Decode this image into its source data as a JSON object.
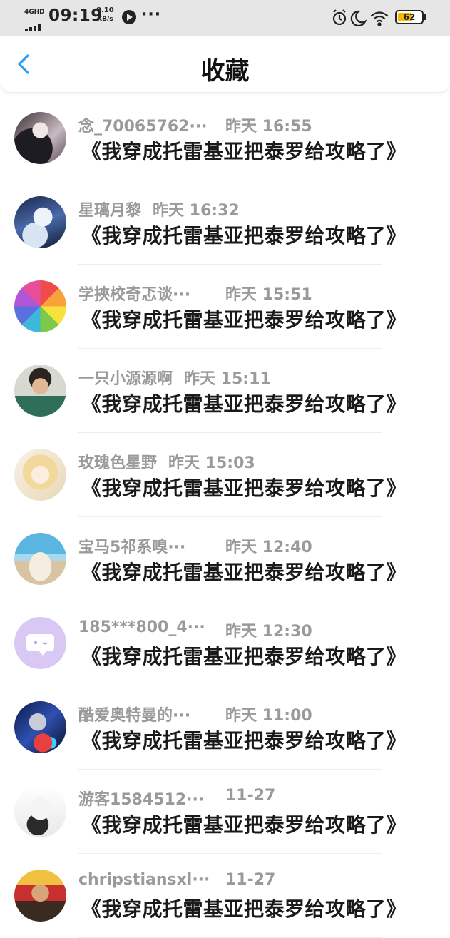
{
  "status_bar": {
    "network": "4GHD",
    "time": "09:19",
    "speed_value": "0.10",
    "speed_unit": "KB/s",
    "more": "···",
    "battery": "62",
    "battery_level": 0.62
  },
  "header": {
    "title": "收藏"
  },
  "favorites": [
    {
      "user": "念_70065762···",
      "time": "昨天 16:55",
      "title": "《我穿成托雷基亚把泰罗给攻略了》",
      "avatar": "dark-girl-avatar"
    },
    {
      "user": "星璃月黎",
      "time": "昨天 16:32",
      "title": "《我穿成托雷基亚把泰罗给攻略了》",
      "avatar": "anime-white-hair-avatar"
    },
    {
      "user": "学挾校奇忑谈···",
      "time": "昨天 15:51",
      "title": "《我穿成托雷基亚把泰罗给攻略了》",
      "avatar": "rainbow-lemon-avatar"
    },
    {
      "user": "一只小源源啊",
      "time": "昨天 15:11",
      "title": "《我穿成托雷基亚把泰罗给攻略了》",
      "avatar": "boy-photo-avatar"
    },
    {
      "user": "玫瑰色星野",
      "time": "昨天 15:03",
      "title": "《我穿成托雷基亚把泰罗给攻略了》",
      "avatar": "anime-blonde-avatar"
    },
    {
      "user": "宝马5祁系嗅···",
      "time": "昨天 12:40",
      "title": "《我穿成托雷基亚把泰罗给攻略了》",
      "avatar": "seashell-avatar"
    },
    {
      "user": "185***800_4···",
      "time": "昨天 12:30",
      "title": "《我穿成托雷基亚把泰罗给攻略了》",
      "avatar": "default-chat-avatar"
    },
    {
      "user": "酷爱奥特曼的···",
      "time": "昨天 11:00",
      "title": "《我穿成托雷基亚把泰罗给攻略了》",
      "avatar": "ultraman-avatar"
    },
    {
      "user": "游客1584512···",
      "time": "11-27",
      "title": "《我穿成托雷基亚把泰罗给攻略了》",
      "avatar": "goat-avatar"
    },
    {
      "user": "chripstiansxl···",
      "time": "11-27",
      "title": "《我穿成托雷基亚把泰罗给攻略了》",
      "avatar": "red-figure-avatar"
    }
  ]
}
